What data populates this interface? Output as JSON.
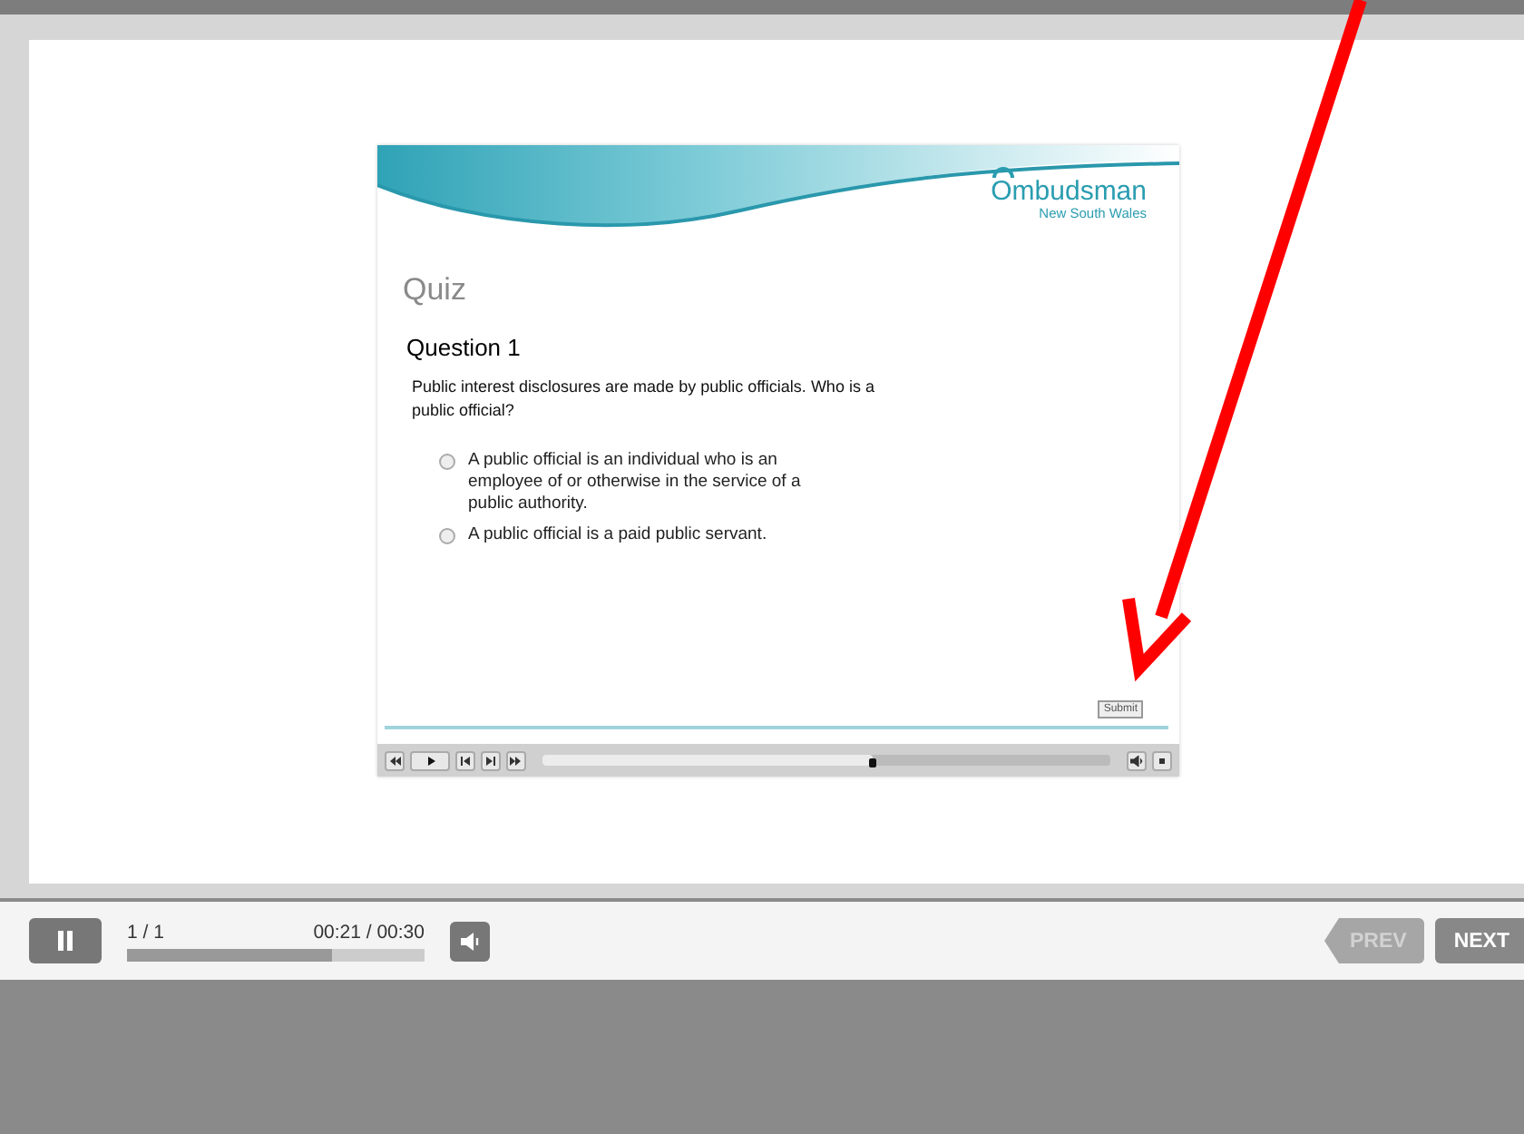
{
  "slide": {
    "brand": "Ombudsman",
    "brand_sub": "New South Wales",
    "title": "Quiz",
    "question": "Question 1",
    "prompt": "Public interest disclosures are made by public officials. Who is a public official?",
    "options": [
      {
        "text": "A public official is an individual who is an employee of or otherwise in the service of a public authority.",
        "selected": false
      },
      {
        "text": "A public official is a paid public servant.",
        "selected": false
      }
    ],
    "submit": "Submit",
    "player": {
      "level": 0.58
    }
  },
  "controls": {
    "page": "1 / 1",
    "time": "00:21 / 00:30",
    "level": 0.69,
    "prev": {
      "label": "PREV",
      "disabled": true
    },
    "next": {
      "label": "NEXT",
      "disabled": false
    }
  }
}
